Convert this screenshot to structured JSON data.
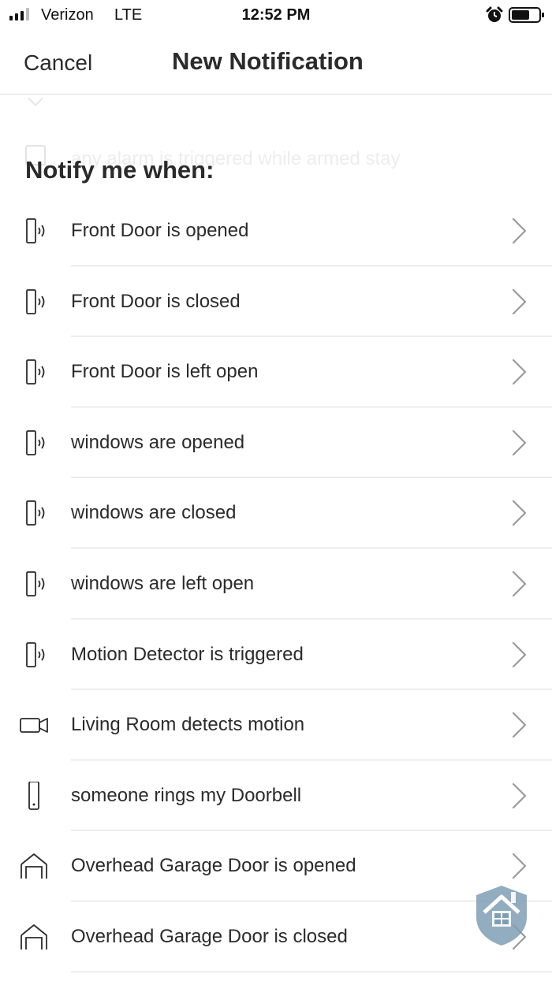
{
  "status_bar": {
    "carrier": "Verizon",
    "network": "LTE",
    "time": "12:52 PM",
    "icons": [
      "signal-icon",
      "alarm-icon",
      "battery-icon"
    ]
  },
  "nav": {
    "cancel_label": "Cancel",
    "title": "New Notification"
  },
  "ghost": {
    "text": "any alarm is triggered while armed stay"
  },
  "section": {
    "heading": "Notify me when:"
  },
  "items": [
    {
      "label": "Front Door is opened",
      "icon": "contact-sensor-icon"
    },
    {
      "label": "Front Door is closed",
      "icon": "contact-sensor-icon"
    },
    {
      "label": "Front Door is left open",
      "icon": "contact-sensor-icon"
    },
    {
      "label": "windows are opened",
      "icon": "contact-sensor-icon"
    },
    {
      "label": "windows are closed",
      "icon": "contact-sensor-icon"
    },
    {
      "label": "windows are left open",
      "icon": "contact-sensor-icon"
    },
    {
      "label": "Motion Detector is triggered",
      "icon": "contact-sensor-icon"
    },
    {
      "label": "Living Room detects motion",
      "icon": "camera-icon"
    },
    {
      "label": "someone rings my Doorbell",
      "icon": "doorbell-icon"
    },
    {
      "label": "Overhead Garage Door is opened",
      "icon": "garage-icon"
    },
    {
      "label": "Overhead Garage Door is closed",
      "icon": "garage-icon"
    }
  ],
  "colors": {
    "text": "#2b2b2b",
    "divider": "#d9d9d9",
    "chevron": "#9a9a9a",
    "badge": "#7f9fb5"
  }
}
